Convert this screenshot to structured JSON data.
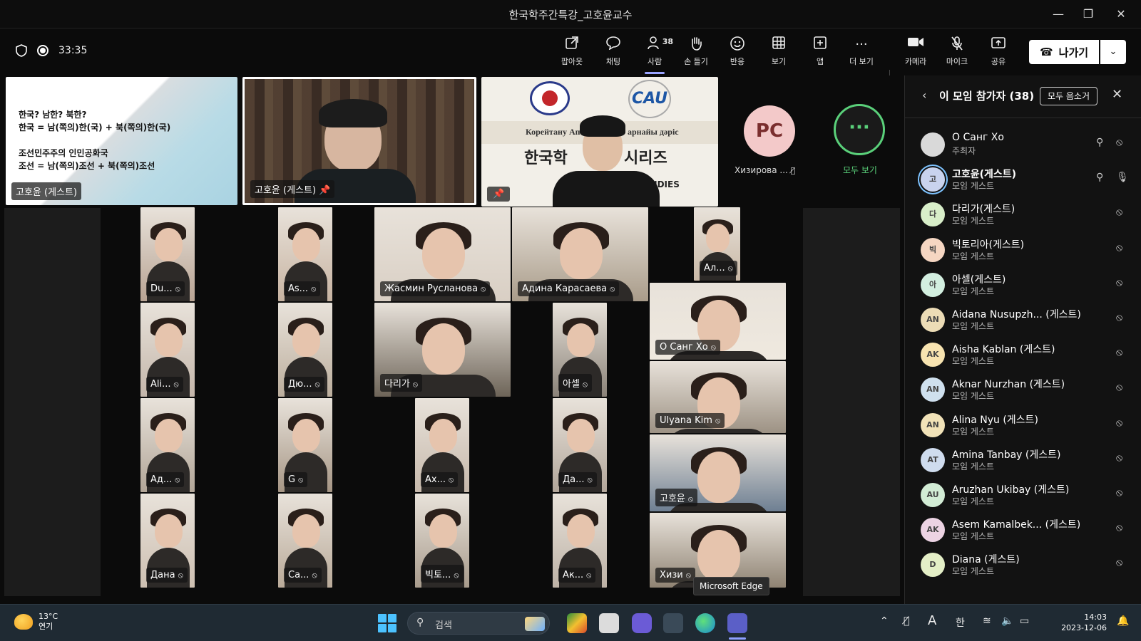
{
  "window": {
    "title": "한국학주간특강_고호윤교수",
    "minimize": "—",
    "restore": "❐",
    "close": "✕"
  },
  "toolbar": {
    "timer": "33:35",
    "items": [
      {
        "label": "팝아웃",
        "icon": "popout-icon"
      },
      {
        "label": "채팅",
        "icon": "chat-icon"
      },
      {
        "label": "사람",
        "icon": "people-icon",
        "count": "38",
        "active": true
      },
      {
        "label": "손 들기",
        "icon": "raise-hand-icon"
      },
      {
        "label": "반응",
        "icon": "reaction-icon"
      },
      {
        "label": "보기",
        "icon": "view-icon"
      },
      {
        "label": "앱",
        "icon": "apps-icon"
      },
      {
        "label": "더 보기",
        "icon": "more-icon"
      },
      {
        "label": "카메라",
        "icon": "camera-icon"
      },
      {
        "label": "마이크",
        "icon": "mic-off-icon"
      },
      {
        "label": "공유",
        "icon": "share-icon"
      }
    ],
    "leave_label": "나가기"
  },
  "stage": {
    "slide": {
      "lines": [
        "한국? 남한? 북한?",
        "한국 = 남(쪽의)한(국) + 북(쪽의)한(국)",
        "",
        "조선민주주의 인민공화국",
        "조선 = 남(쪽의)조선 + 북(쪽의)조선"
      ],
      "name": "고호윤 (게스트)"
    },
    "speaker_name": "고호윤 (게스트)",
    "banner": {
      "left_text": "Корейтану Ап",
      "right_text": "арнайы дәріс",
      "main_left": "한국학",
      "main_right": "시리즈",
      "footer": "STUDIES",
      "logo_text": "CAU"
    },
    "pc": {
      "initials": "PC",
      "name": "Хизирова ..."
    },
    "see_all_label": "모두 보기",
    "grid_names": [
      "Du...",
      "As...",
      "Жасмин Русланова",
      "Адина Карасаева",
      "Ал...",
      "Ali...",
      "Дю...",
      "다리가",
      "아셀",
      "О Санг Хо",
      "Ulyana Kim",
      "Ад...",
      "G",
      "Ах...",
      "Да...",
      "고호윤",
      "Дана",
      "Са...",
      "빅토...",
      "Ак...",
      "Хизи"
    ]
  },
  "panel": {
    "title": "이 모임 참가자 (38)",
    "mute_all": "모두 음소거",
    "participants": [
      {
        "name": "О Санг Хо",
        "role": "주최자",
        "initials": "",
        "color": "#d9d9d9",
        "pinned": true
      },
      {
        "name": "고호윤(게스트)",
        "role": "모임 게스트",
        "initials": "고",
        "color": "#c9d3ee",
        "pinned": true,
        "speaking": true
      },
      {
        "name": "다리가(게스트)",
        "role": "모임 게스트",
        "initials": "다",
        "color": "#d8eec9"
      },
      {
        "name": "빅토리아(게스트)",
        "role": "모임 게스트",
        "initials": "빅",
        "color": "#f5d6c2"
      },
      {
        "name": "아셀(게스트)",
        "role": "모임 게스트",
        "initials": "아",
        "color": "#d3efe0"
      },
      {
        "name": "Aidana Nusupzh... (게스트)",
        "role": "모임 게스트",
        "initials": "AN",
        "color": "#ecdcb6"
      },
      {
        "name": "Aisha Kablan (게스트)",
        "role": "모임 게스트",
        "initials": "AK",
        "color": "#f7e3b0"
      },
      {
        "name": "Aknar Nurzhan (게스트)",
        "role": "모임 게스트",
        "initials": "AN",
        "color": "#cfe0ee"
      },
      {
        "name": "Alina Nyu (게스트)",
        "role": "모임 게스트",
        "initials": "AN",
        "color": "#f1e2b8"
      },
      {
        "name": "Amina Tanbay (게스트)",
        "role": "모임 게스트",
        "initials": "AT",
        "color": "#cfdcee"
      },
      {
        "name": "Aruzhan Ukibay (게스트)",
        "role": "모임 게스트",
        "initials": "AU",
        "color": "#d2ecd5"
      },
      {
        "name": "Asem Kamalbek... (게스트)",
        "role": "모임 게스트",
        "initials": "AK",
        "color": "#ecd3e3"
      },
      {
        "name": "Diana (게스트)",
        "role": "모임 게스트",
        "initials": "D",
        "color": "#e4efc7"
      }
    ]
  },
  "taskbar": {
    "weather_temp": "13°C",
    "weather_desc": "연기",
    "search_placeholder": "검색",
    "ime": "한",
    "font_icon": "A",
    "time": "14:03",
    "date": "2023-12-06",
    "tooltip": "Microsoft Edge"
  }
}
